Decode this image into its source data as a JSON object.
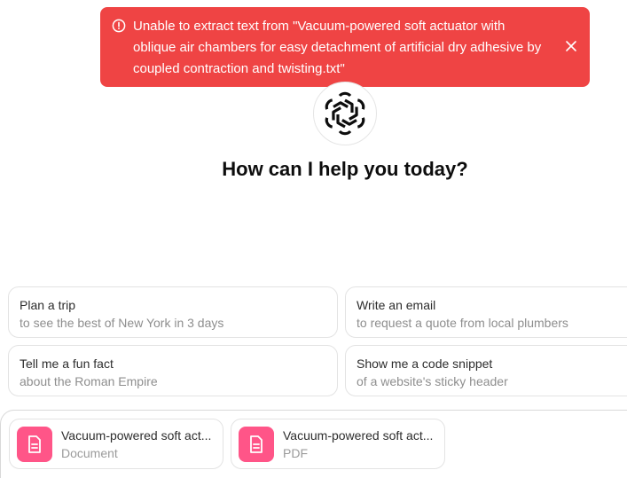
{
  "toast": {
    "message": "Unable to extract text from \"Vacuum-powered soft actuator with oblique air chambers for easy detachment of artificial dry adhesive by coupled contraction and twisting.txt\"",
    "icon": "alert-circle-icon",
    "close_icon": "close-icon",
    "color": "#ef4444"
  },
  "logo": {
    "icon": "openai-logo-icon"
  },
  "headline": "How can I help you today?",
  "suggestions": [
    {
      "title": "Plan a trip",
      "subtitle": "to see the best of New York in 3 days"
    },
    {
      "title": "Write an email",
      "subtitle": "to request a quote from local plumbers"
    },
    {
      "title": "Tell me a fun fact",
      "subtitle": "about the Roman Empire"
    },
    {
      "title": "Show me a code snippet",
      "subtitle": "of a website's sticky header"
    }
  ],
  "attachments": [
    {
      "name": "Vacuum-powered soft act...",
      "type": "Document",
      "icon": "document-icon",
      "color": "#ff5588"
    },
    {
      "name": "Vacuum-powered soft act...",
      "type": "PDF",
      "icon": "document-icon",
      "color": "#ff5588"
    }
  ]
}
